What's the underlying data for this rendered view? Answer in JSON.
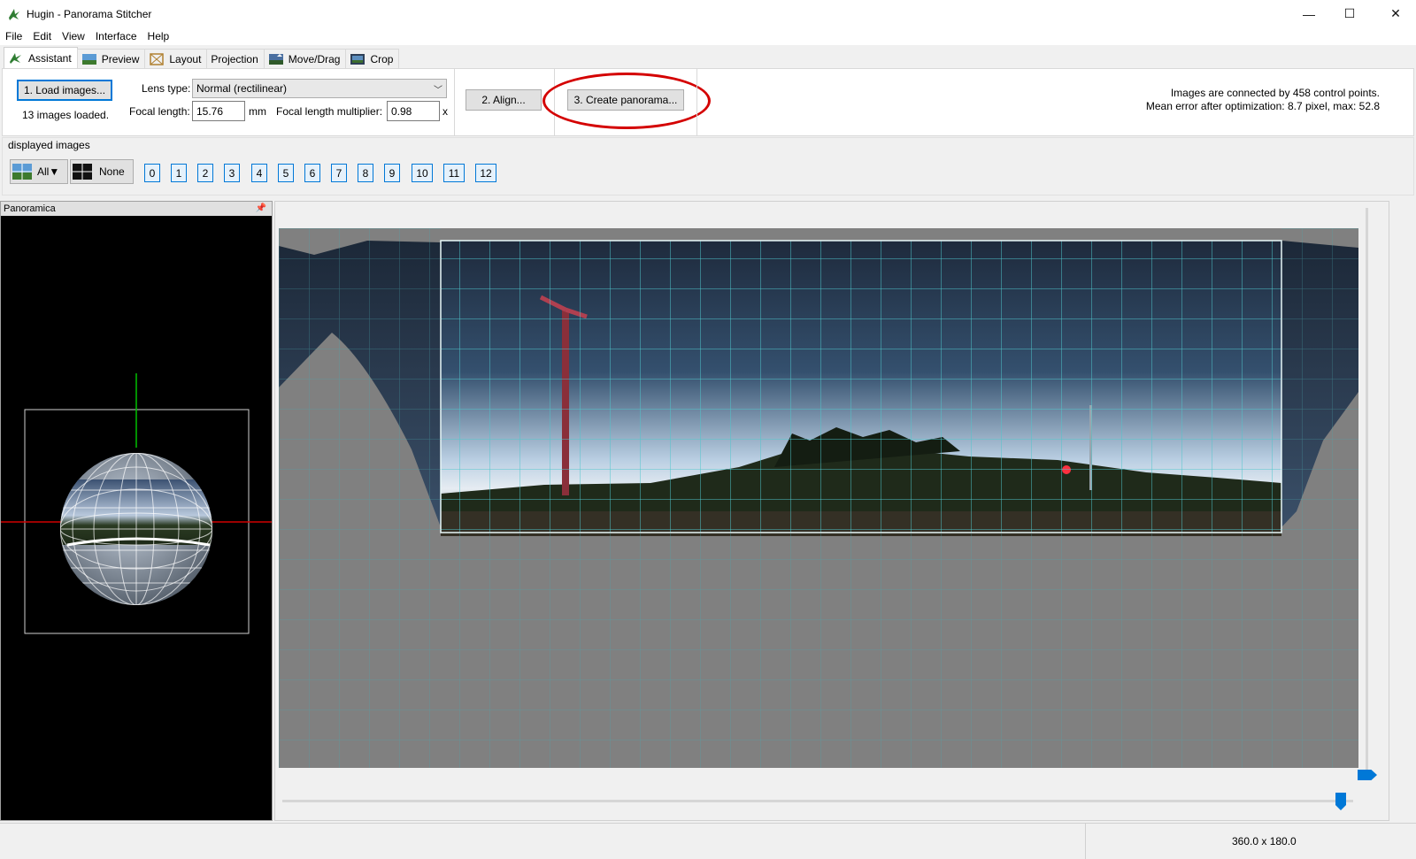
{
  "window": {
    "title": "Hugin - Panorama Stitcher",
    "controls": {
      "minimize": "—",
      "maximize": "☐",
      "close": "✕"
    }
  },
  "menu": [
    "File",
    "Edit",
    "View",
    "Interface",
    "Help"
  ],
  "tabs": [
    {
      "label": "Assistant",
      "icon": "hugin-icon",
      "active": true
    },
    {
      "label": "Preview",
      "icon": "preview-icon",
      "active": false
    },
    {
      "label": "Layout",
      "icon": "layout-icon",
      "active": false
    },
    {
      "label": "Projection",
      "icon": "",
      "active": false
    },
    {
      "label": "Move/Drag",
      "icon": "move-drag-icon",
      "active": false
    },
    {
      "label": "Crop",
      "icon": "crop-icon",
      "active": false
    }
  ],
  "assistant": {
    "load_button": "1. Load images...",
    "images_loaded": "13 images loaded.",
    "lens_type_label": "Lens type:",
    "lens_type_value": "Normal (rectilinear)",
    "focal_length_label": "Focal length:",
    "focal_length_value": "15.76",
    "focal_length_unit": "mm",
    "multiplier_label": "Focal length multiplier:",
    "multiplier_value": "0.98",
    "multiplier_unit": "x",
    "align_button": "2. Align...",
    "create_button": "3. Create panorama...",
    "status_line1": "Images are connected by 458 control points.",
    "status_line2": "Mean error after optimization: 8.7 pixel, max: 52.8"
  },
  "displayed_images": {
    "label": "displayed images",
    "all_button": "All▼",
    "none_button": "None",
    "images": [
      "0",
      "1",
      "2",
      "3",
      "4",
      "5",
      "6",
      "7",
      "8",
      "9",
      "10",
      "11",
      "12"
    ]
  },
  "panoramica": {
    "title": "Panoramica"
  },
  "status": {
    "fov": "360.0 x 180.0"
  },
  "colors": {
    "accent": "#0078d7",
    "highlight_ring": "#d40000",
    "grid": "#5fd3d8"
  }
}
